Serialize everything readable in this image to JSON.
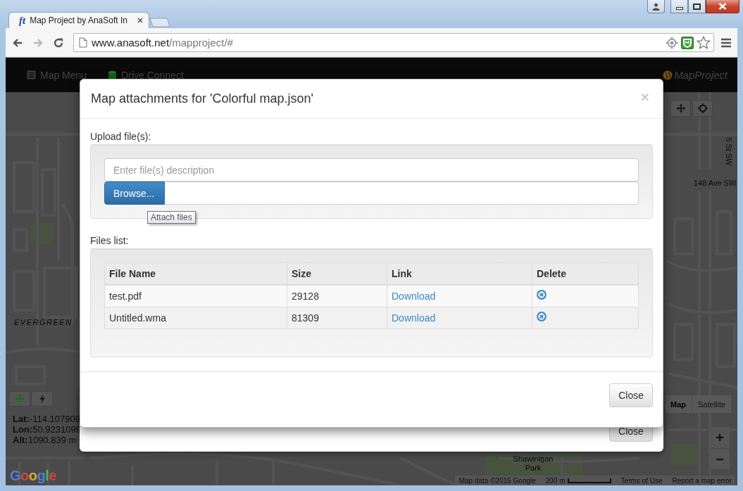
{
  "window": {
    "tab": {
      "favicon": "ft",
      "title": "Map Project by AnaSoft In"
    },
    "address_bar": {
      "host": "www.anasoft.net",
      "path": "/mapproject/#"
    }
  },
  "navbar": {
    "items": [
      {
        "label": "Map Menu",
        "kind": "menu"
      },
      {
        "label": "Drive Connect",
        "kind": "drive"
      }
    ],
    "brand": "MapProject"
  },
  "map": {
    "labels": [
      {
        "text": "EVERGREEN",
        "kind": "district"
      },
      {
        "text": "148 Ave SW",
        "kind": "street"
      },
      {
        "text": "5 St SW",
        "kind": "street-vertical"
      },
      {
        "text": "Shawinigan Park",
        "kind": "park"
      }
    ],
    "coordinates": [
      "**Lat:**-114.107909",
      "**Lon:**50.9231099",
      "**Alt:**1090.839 m"
    ],
    "map_types": [
      {
        "label": "Map",
        "selected": true
      },
      {
        "label": "Satellite",
        "selected": false
      }
    ],
    "zoom_controls": [
      "+",
      "−"
    ],
    "logo": "Google",
    "attribution": {
      "map_data": "Map data ©2015 Google",
      "scale": "200 m",
      "terms": "Terms of Use",
      "report": "Report a map error"
    }
  },
  "background_dialog": {
    "close_button": "Close"
  },
  "dialog": {
    "title": "Map attachments for 'Colorful map.json'",
    "close": "×",
    "upload_label": "Upload file(s):",
    "description_field": {
      "placeholder": "Enter file(s) description"
    },
    "browse_button": "Browse...",
    "tooltip": "Attach files",
    "files_label": "Files list:",
    "table": {
      "columns": [
        "File Name",
        "Size",
        "Link",
        "Delete"
      ],
      "rows": [
        {
          "file_name": "test.pdf",
          "size": "29128",
          "link": "Download"
        },
        {
          "file_name": "Untitled.wma",
          "size": "81309",
          "link": "Download"
        }
      ]
    },
    "close_button": "Close"
  }
}
